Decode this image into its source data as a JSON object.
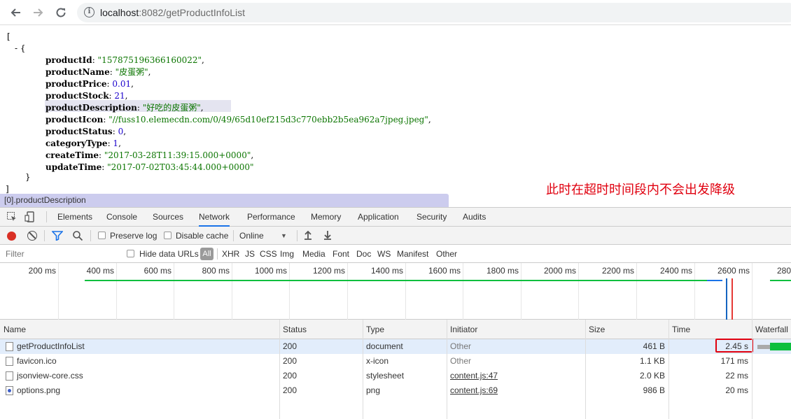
{
  "browser": {
    "url_host": "localhost",
    "url_path": ":8082/getProductInfoList"
  },
  "json_view": {
    "open_bracket": "[",
    "collapse_toggle": "- {",
    "fields": [
      {
        "key": "productId",
        "value": "\"157875196366160022\"",
        "type": "string",
        "suffix": ","
      },
      {
        "key": "productName",
        "value": "\"皮蛋粥\"",
        "type": "string",
        "suffix": ","
      },
      {
        "key": "productPrice",
        "value": "0.01",
        "type": "number",
        "suffix": ","
      },
      {
        "key": "productStock",
        "value": "21",
        "type": "number",
        "suffix": ","
      },
      {
        "key": "productDescription",
        "value": "\"好吃的皮蛋粥\"",
        "type": "string",
        "suffix": ","
      },
      {
        "key": "productIcon",
        "value": "\"//fuss10.elemecdn.com/0/49/65d10ef215d3c770ebb2b5ea962a7jpeg.jpeg\"",
        "type": "string",
        "suffix": ","
      },
      {
        "key": "productStatus",
        "value": "0",
        "type": "number",
        "suffix": ","
      },
      {
        "key": "categoryType",
        "value": "1",
        "type": "number",
        "suffix": ","
      },
      {
        "key": "createTime",
        "value": "\"2017-03-28T11:39:15.000+0000\"",
        "type": "string",
        "suffix": ","
      },
      {
        "key": "updateTime",
        "value": "\"2017-07-02T03:45:44.000+0000\"",
        "type": "string",
        "suffix": ""
      }
    ],
    "close_brace": "}",
    "close_bracket": "]",
    "path_tooltip": "[0].productDescription",
    "annotation": "此时在超时时间段内不会出发降级"
  },
  "devtools": {
    "tabs": [
      "Elements",
      "Console",
      "Sources",
      "Network",
      "Performance",
      "Memory",
      "Application",
      "Security",
      "Audits"
    ],
    "selected_tab": "Network",
    "toolbar": {
      "preserve_log": "Preserve log",
      "disable_cache": "Disable cache",
      "throttle": "Online",
      "throttle_caret": "▼"
    },
    "filter": {
      "placeholder": "Filter",
      "hide_data_urls": "Hide data URLs",
      "all": "All",
      "types": [
        "XHR",
        "JS",
        "CSS",
        "Img",
        "Media",
        "Font",
        "Doc",
        "WS",
        "Manifest",
        "Other"
      ]
    },
    "timeline_ticks": [
      "200 ms",
      "400 ms",
      "600 ms",
      "800 ms",
      "1000 ms",
      "1200 ms",
      "1400 ms",
      "1600 ms",
      "1800 ms",
      "2000 ms",
      "2200 ms",
      "2400 ms",
      "2600 ms",
      "280"
    ],
    "table": {
      "columns": [
        "Name",
        "Status",
        "Type",
        "Initiator",
        "Size",
        "Time",
        "Waterfall"
      ],
      "rows": [
        {
          "name": "getProductInfoList",
          "status": "200",
          "type": "document",
          "initiator": "Other",
          "size": "461 B",
          "time": "2.45 s"
        },
        {
          "name": "favicon.ico",
          "status": "200",
          "type": "x-icon",
          "initiator": "Other",
          "size": "1.1 KB",
          "time": "171 ms"
        },
        {
          "name": "jsonview-core.css",
          "status": "200",
          "type": "stylesheet",
          "initiator": "content.js:47",
          "size": "2.0 KB",
          "time": "22 ms"
        },
        {
          "name": "options.png",
          "status": "200",
          "type": "png",
          "initiator": "content.js:69",
          "size": "986 B",
          "time": "20 ms"
        }
      ]
    }
  },
  "colors": {
    "annotation": "#e0000f",
    "json_string": "#0b7500",
    "json_number": "#1a01cc",
    "record": "#d93025",
    "waterfall_bar": "#0cbf3e"
  }
}
